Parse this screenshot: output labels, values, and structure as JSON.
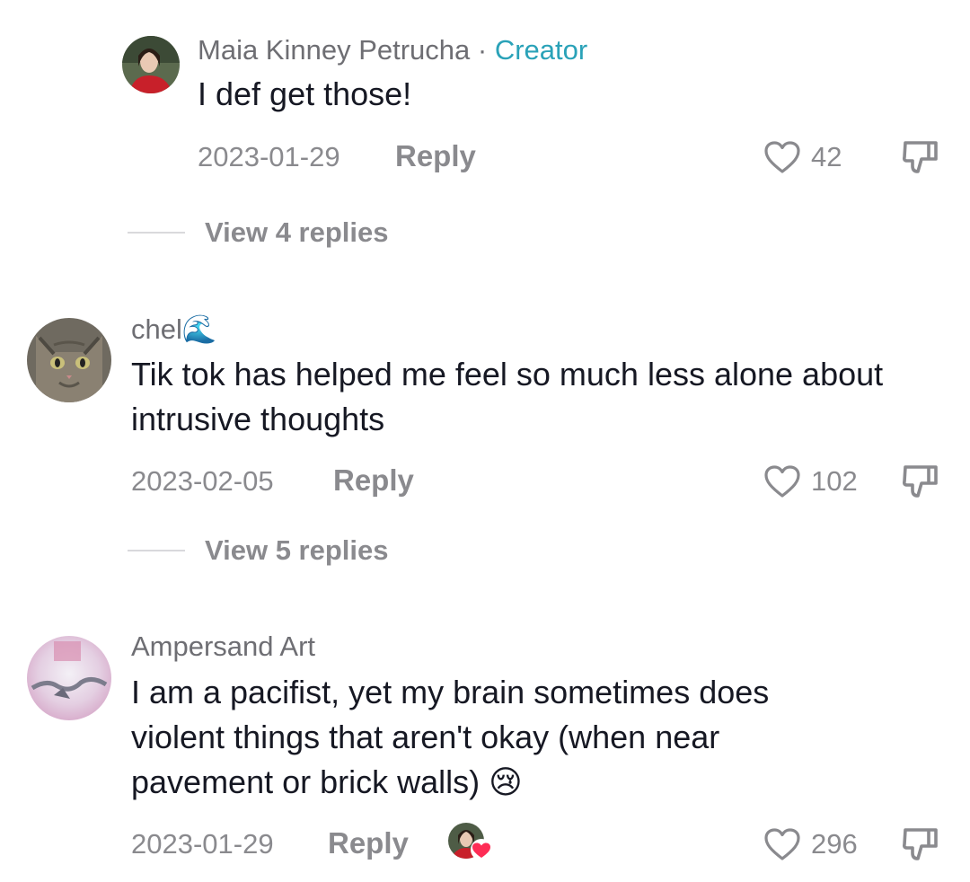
{
  "comments": [
    {
      "author": "Maia Kinney Petrucha",
      "separator": " · ",
      "badge": "Creator",
      "text": "I def get those!",
      "date": "2023-01-29",
      "reply_label": "Reply",
      "likes": "42",
      "view_replies": "View 4 replies"
    },
    {
      "author": "chel🌊",
      "text": "Tik tok has helped me feel so much less alone about intrusive thoughts",
      "date": "2023-02-05",
      "reply_label": "Reply",
      "likes": "102",
      "view_replies": "View 5 replies"
    },
    {
      "author": "Ampersand Art",
      "text": "I am a pacifist, yet my brain sometimes does violent things that aren't okay (when near pavement or brick walls) 😢",
      "date": "2023-01-29",
      "reply_label": "Reply",
      "likes": "296",
      "creator_liked": true
    }
  ],
  "colors": {
    "creator_badge": "#2aa2b8",
    "liked_heart": "#fe2c55",
    "secondary_text": "#8a8a8e"
  },
  "icons": [
    "heart-icon",
    "dislike-icon",
    "creator-liked-heart-icon"
  ]
}
